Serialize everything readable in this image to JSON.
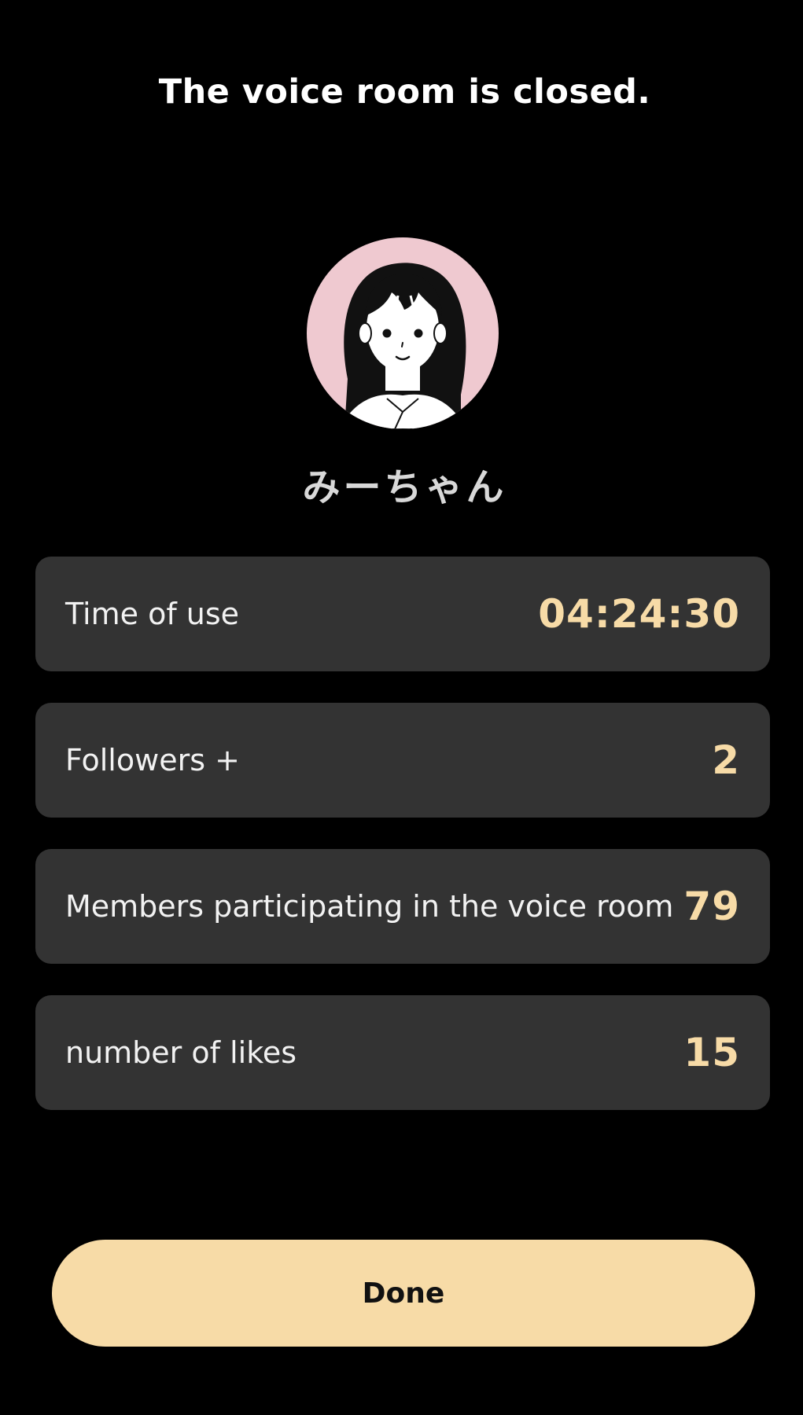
{
  "header": {
    "title": "The voice room is closed."
  },
  "profile": {
    "avatar_icon": "girl-avatar-icon",
    "name": "みーちゃん"
  },
  "stats": [
    {
      "label": "Time of use",
      "value": "04:24:30"
    },
    {
      "label": "Followers +",
      "value": "2"
    },
    {
      "label": "Members participating in the voice room",
      "value": "79"
    },
    {
      "label": "number of likes",
      "value": "15"
    }
  ],
  "actions": {
    "done_label": "Done"
  },
  "colors": {
    "background": "#000000",
    "card": "#333333",
    "accent": "#f7dba7",
    "avatar_bg": "#efc9d0"
  }
}
